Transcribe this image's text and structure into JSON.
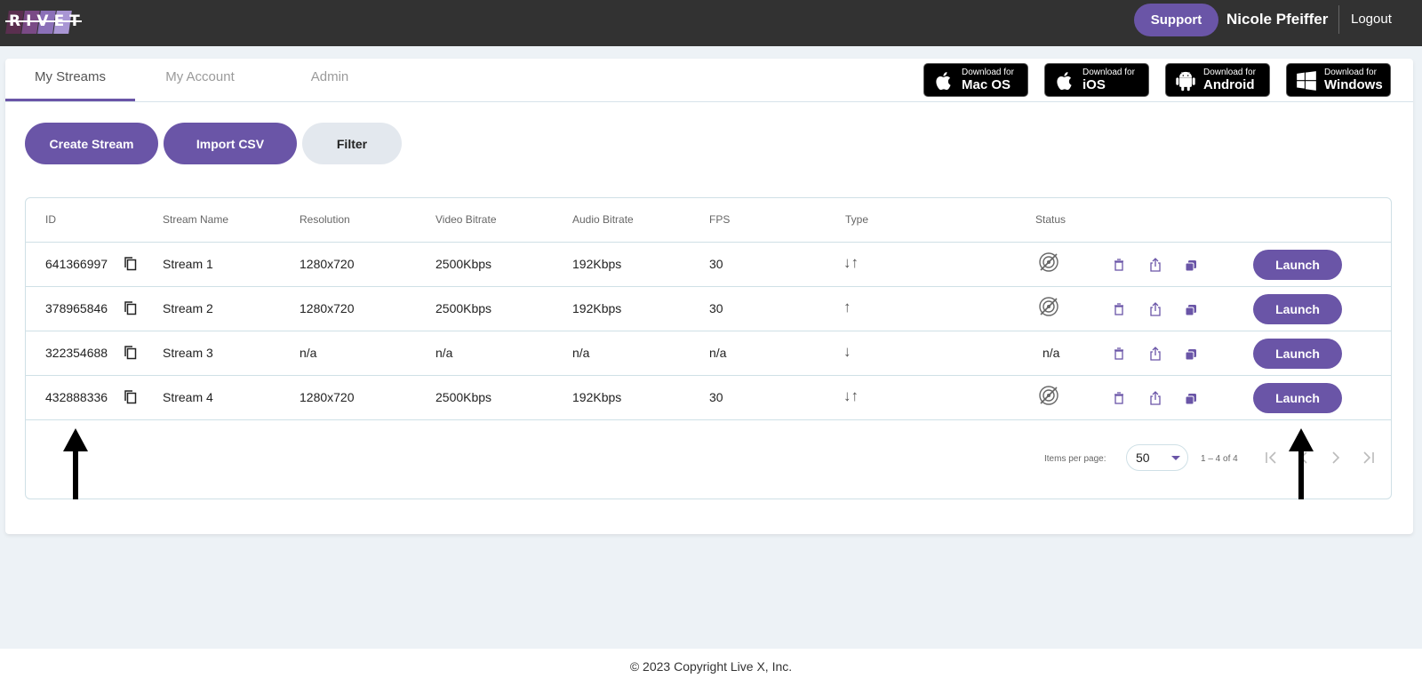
{
  "app": {
    "logo_text": "RIVET",
    "brand_color": "#6a55a7"
  },
  "header": {
    "support_label": "Support",
    "user_name": "Nicole Pfeiffer",
    "logout_label": "Logout"
  },
  "tabs": [
    {
      "label": "My Streams",
      "active": true
    },
    {
      "label": "My Account",
      "active": false
    },
    {
      "label": "Admin",
      "active": false
    }
  ],
  "downloads": [
    {
      "small": "Download for",
      "big": "Mac OS",
      "icon": "apple-icon"
    },
    {
      "small": "Download for",
      "big": "iOS",
      "icon": "apple-icon"
    },
    {
      "small": "Download for",
      "big": "Android",
      "icon": "android-icon"
    },
    {
      "small": "Download for",
      "big": "Windows",
      "icon": "windows-icon"
    }
  ],
  "toolbar": {
    "create_label": "Create Stream",
    "import_label": "Import CSV",
    "filter_label": "Filter"
  },
  "table": {
    "headers": [
      "ID",
      "Stream Name",
      "Resolution",
      "Video Bitrate",
      "Audio Bitrate",
      "FPS",
      "Type",
      "Status"
    ],
    "rows": [
      {
        "id": "641366997",
        "name": "Stream 1",
        "resolution": "1280x720",
        "video_bitrate": "2500Kbps",
        "audio_bitrate": "192Kbps",
        "fps": "30",
        "type": "↓↑",
        "status": "offline-icon",
        "launch": "Launch"
      },
      {
        "id": "378965846",
        "name": "Stream 2",
        "resolution": "1280x720",
        "video_bitrate": "2500Kbps",
        "audio_bitrate": "192Kbps",
        "fps": "30",
        "type": "↑",
        "status": "offline-icon",
        "launch": "Launch"
      },
      {
        "id": "322354688",
        "name": "Stream 3",
        "resolution": "n/a",
        "video_bitrate": "n/a",
        "audio_bitrate": "n/a",
        "fps": "n/a",
        "type": "↓",
        "status": "n/a",
        "launch": "Launch"
      },
      {
        "id": "432888336",
        "name": "Stream 4",
        "resolution": "1280x720",
        "video_bitrate": "2500Kbps",
        "audio_bitrate": "192Kbps",
        "fps": "30",
        "type": "↓↑",
        "status": "offline-icon",
        "launch": "Launch"
      }
    ]
  },
  "paginator": {
    "items_per_page_label": "Items per page:",
    "items_per_page": "50",
    "range": "1 – 4 of 4"
  },
  "footer": {
    "copyright": "© 2023 Copyright Live X, Inc."
  }
}
